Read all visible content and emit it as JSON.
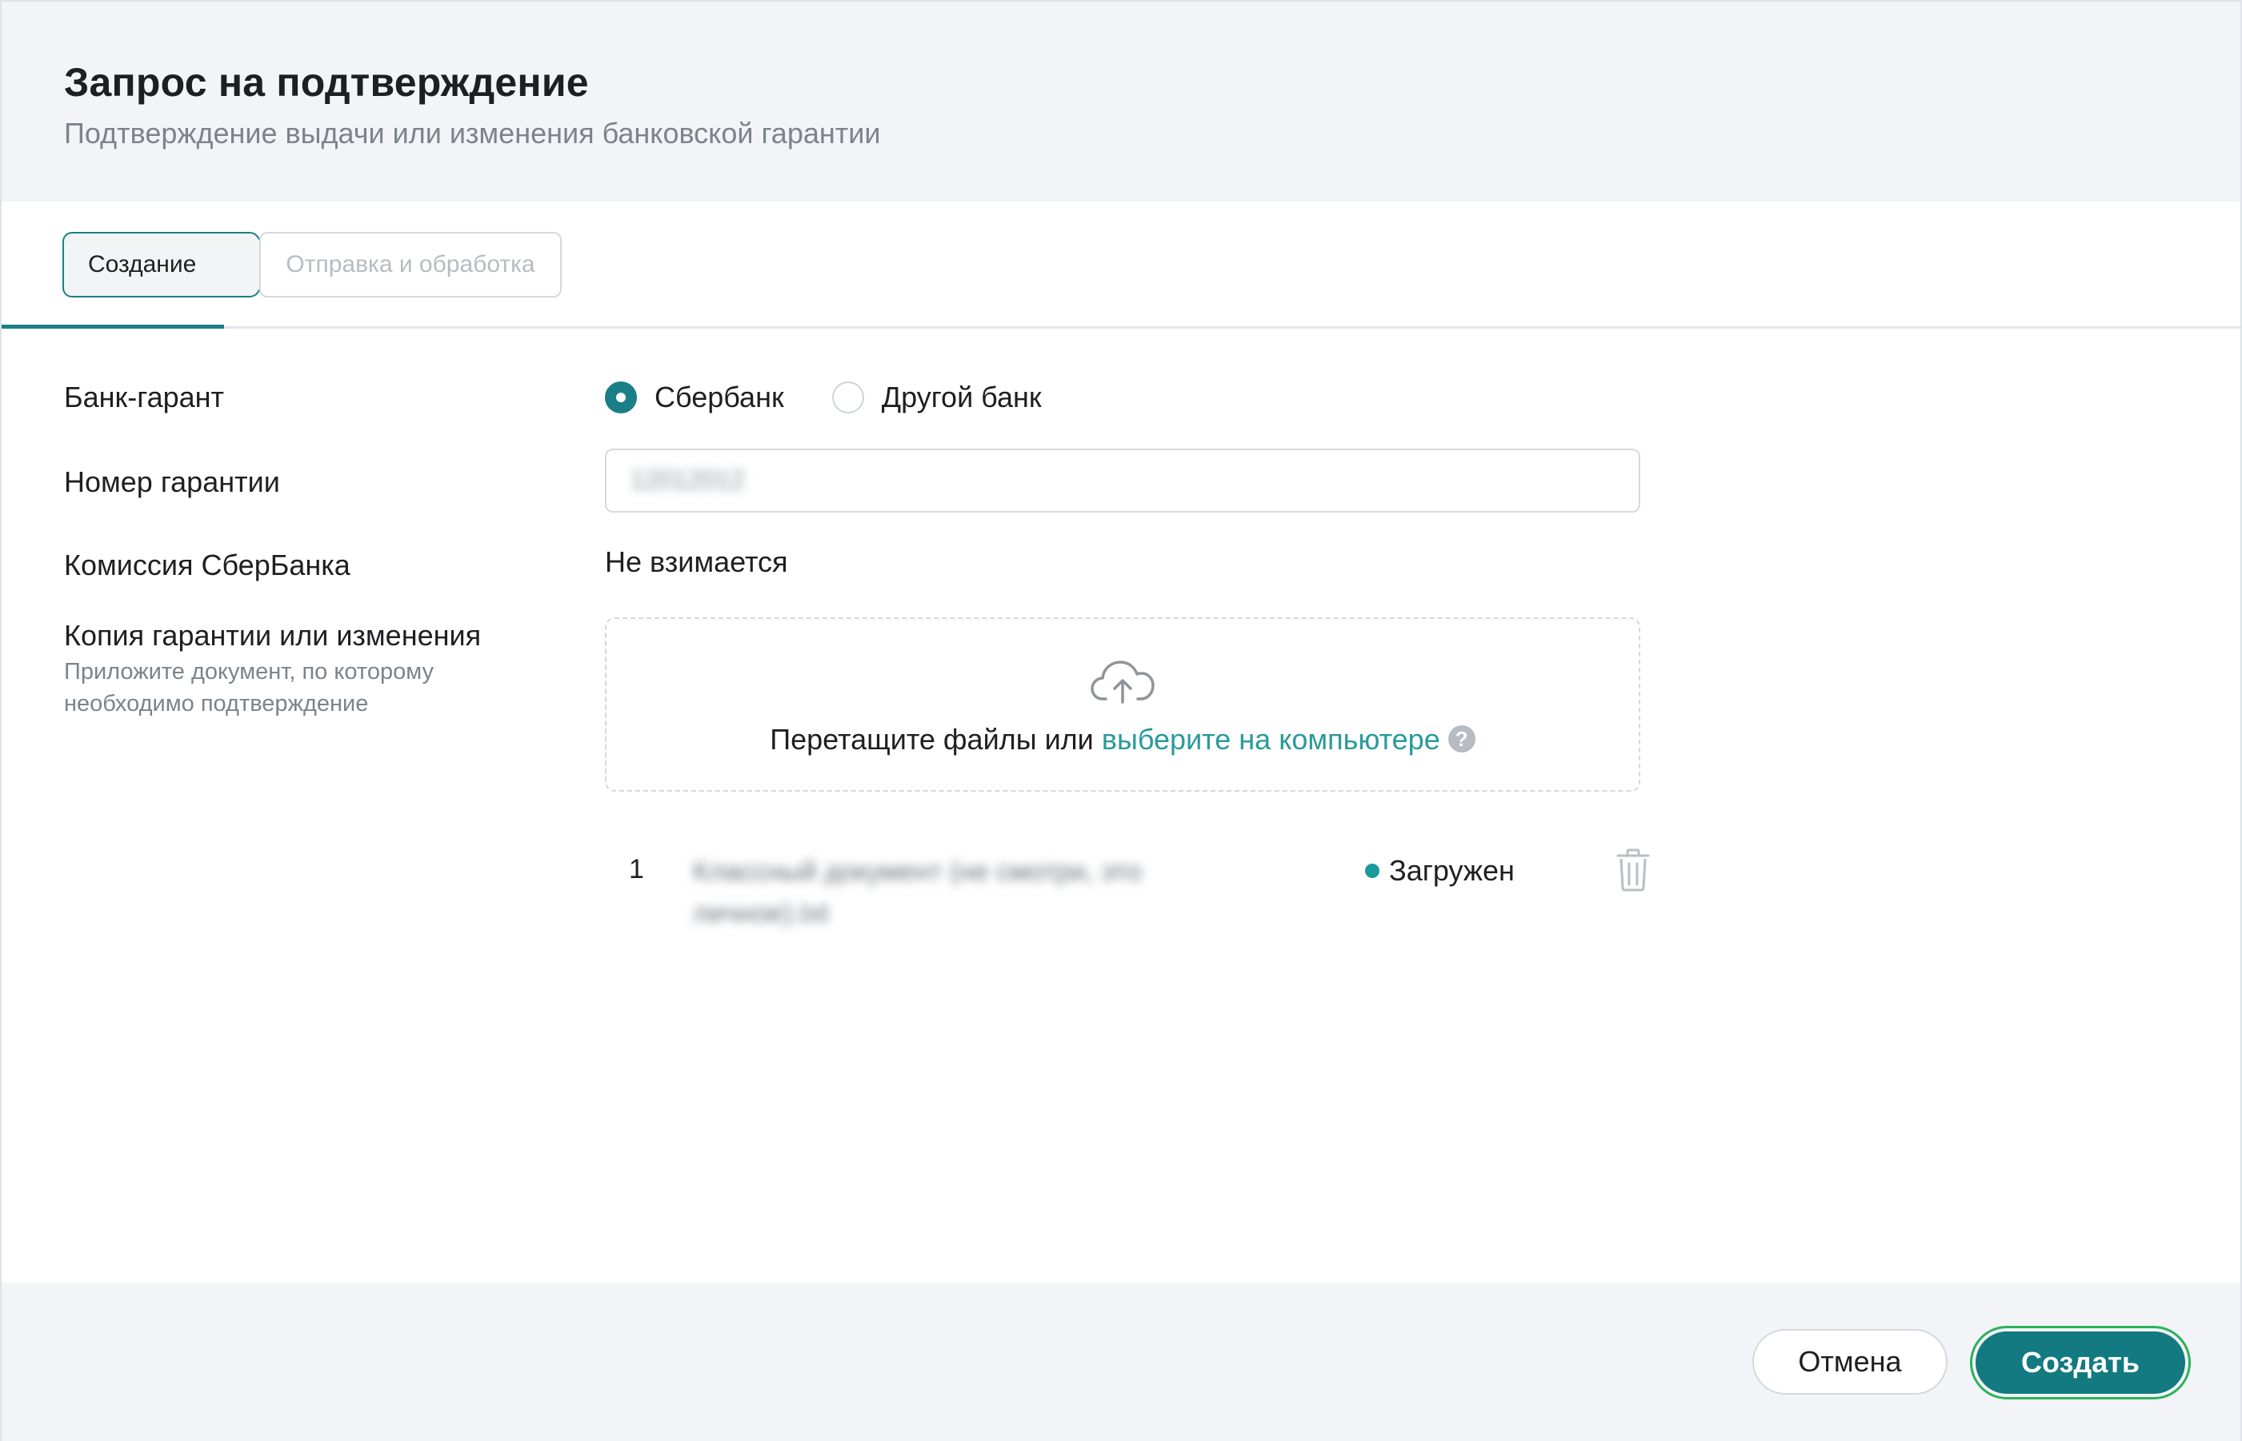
{
  "header": {
    "title": "Запрос на подтверждение",
    "subtitle": "Подтверждение выдачи или изменения банковской гарантии"
  },
  "steps": [
    {
      "label": "Создание",
      "active": true
    },
    {
      "label": "Отправка и обработка",
      "active": false
    }
  ],
  "form": {
    "bank": {
      "label": "Банк-гарант",
      "options": [
        {
          "label": "Сбербанк",
          "checked": true
        },
        {
          "label": "Другой банк",
          "checked": false
        }
      ]
    },
    "guarantee_number": {
      "label": "Номер гарантии",
      "value": "12012012"
    },
    "commission": {
      "label": "Комиссия СберБанка",
      "value": "Не взимается"
    },
    "attachment": {
      "label": "Копия гарантии или изменения",
      "hint": "Приложите документ, по которому необходимо подтверждение",
      "drop_text": "Перетащите файлы или",
      "drop_link": "выберите на компьютере",
      "help": "?"
    }
  },
  "files": [
    {
      "index": "1",
      "name": "Классный документ (не смотри, это личное).txt",
      "status": "Загружен"
    }
  ],
  "footer": {
    "cancel_label": "Отмена",
    "create_label": "Создать"
  },
  "colors": {
    "accent": "#127a80",
    "link": "#2a9a9a",
    "focus_ring": "#2bb15a",
    "status_ok": "#1a9a9a"
  }
}
